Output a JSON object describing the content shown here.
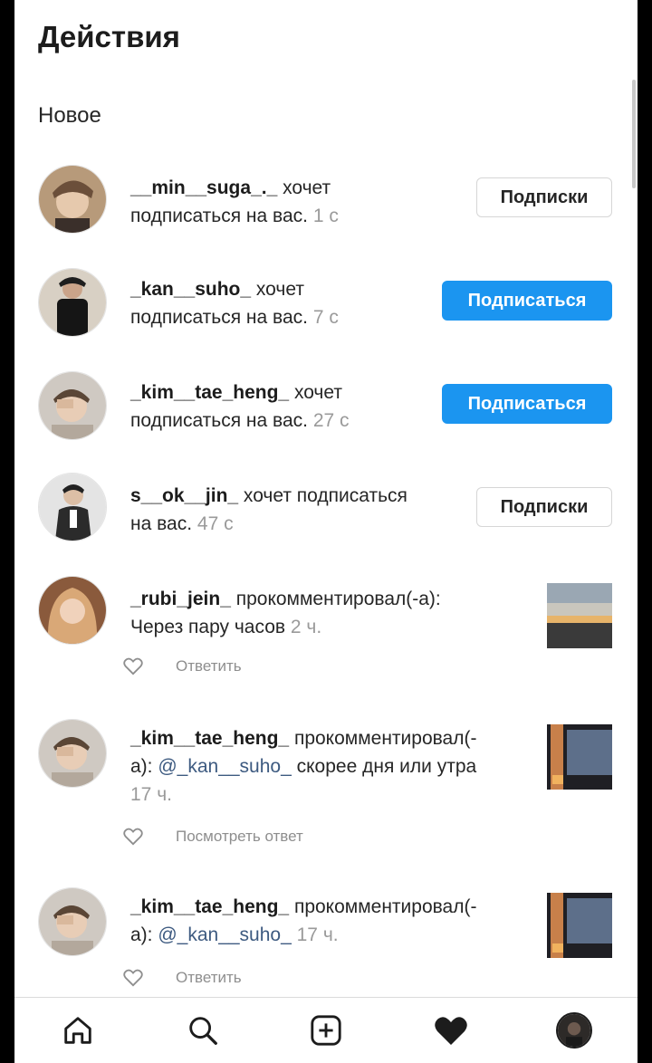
{
  "header": {
    "title": "Действия"
  },
  "section_new": "Новое",
  "requests": [
    {
      "user": "__min__suga_._",
      "text_line1": " хочет",
      "text_line2": "подписаться на вас.",
      "time": "1 с",
      "button": "Подписки"
    },
    {
      "user": "_kan__suho_",
      "text_line1": " хочет",
      "text_line2": "подписаться на вас.",
      "time": "7 с",
      "button": "Подписаться"
    },
    {
      "user": "_kim__tae_heng_",
      "text_line1": " хочет",
      "text_line2": "подписаться на вас.",
      "time": "27 с",
      "button": "Подписаться"
    },
    {
      "user": "s__ok__jin_",
      "text_line1": " хочет подписаться",
      "text_line2": "на вас.",
      "time": "47 с",
      "button": "Подписки"
    }
  ],
  "comments": [
    {
      "user": "_rubi_jein_",
      "action": " прокомментировал(-а):",
      "line2": "Через пару часов",
      "time": "2 ч.",
      "reply": "Ответить"
    },
    {
      "user": "_kim__tae_heng_",
      "action": " прокомментировал(-",
      "line2_prefix": "а): ",
      "mention": "@_kan__suho_",
      "line2_suffix": " скорее дня или утра",
      "time": "17 ч.",
      "reply": "Посмотреть ответ"
    },
    {
      "user": "_kim__tae_heng_",
      "action": " прокомментировал(-",
      "line2_prefix": "а): ",
      "mention": "@_kan__suho_",
      "time": "17 ч.",
      "reply": "Ответить"
    }
  ],
  "nav": [
    "home-icon",
    "search-icon",
    "add-post-icon",
    "activity-heart-icon",
    "profile-avatar"
  ],
  "colors": {
    "follow_button": "#1b95f0",
    "mention": "#3d5a80",
    "time": "#9a9a9a"
  }
}
